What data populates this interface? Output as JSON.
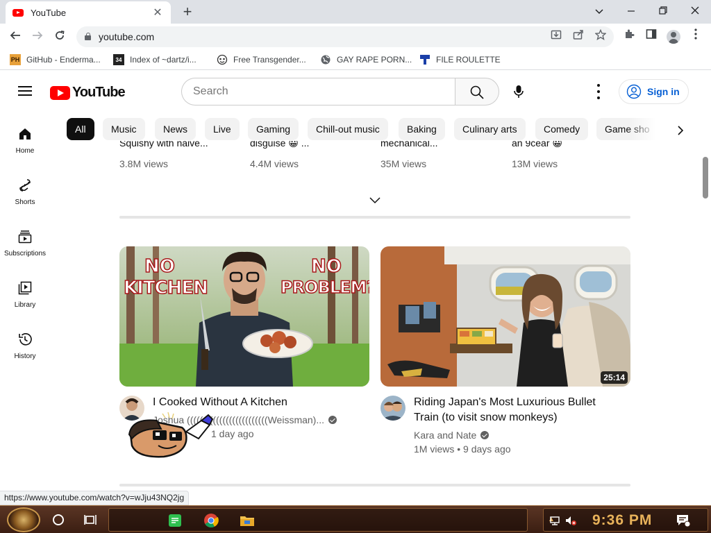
{
  "browser": {
    "tab_title": "YouTube",
    "url": "youtube.com",
    "bookmarks": [
      {
        "label": "GitHub - Enderma..."
      },
      {
        "label": "Index of ~dartz/i..."
      },
      {
        "label": "Free Transgender..."
      },
      {
        "label": "GAY RAPE PORN..."
      },
      {
        "label": "FILE ROULETTE"
      }
    ],
    "bookmark_badges": {
      "github": "PH",
      "index": "34"
    },
    "status_url": "https://www.youtube.com/watch?v=wJju43NQ2jg"
  },
  "header": {
    "logo_text": "YouTube",
    "search_placeholder": "Search",
    "signin_label": "Sign in"
  },
  "guide": [
    {
      "label": "Home"
    },
    {
      "label": "Shorts"
    },
    {
      "label": "Subscriptions"
    },
    {
      "label": "Library"
    },
    {
      "label": "History"
    }
  ],
  "chips": [
    {
      "label": "All",
      "active": true
    },
    {
      "label": "Music"
    },
    {
      "label": "News"
    },
    {
      "label": "Live"
    },
    {
      "label": "Gaming"
    },
    {
      "label": "Chill-out music"
    },
    {
      "label": "Baking"
    },
    {
      "label": "Culinary arts"
    },
    {
      "label": "Comedy"
    },
    {
      "label": "Game sho"
    }
  ],
  "shorts_shelf": [
    {
      "title_cut": "Squishy with naive...",
      "views": "3.8M views"
    },
    {
      "title_cut": "disguise 😀 ...",
      "views": "4.4M views"
    },
    {
      "title_cut": "mechanical...",
      "views": "35M views"
    },
    {
      "title_cut": "an 9cear 😀",
      "views": "13M views"
    }
  ],
  "videos": [
    {
      "title": "I Cooked Without A Kitchen",
      "channel": "Joshua (((((((((((((((((((((((((Weissman)...",
      "meta": "1 day ago",
      "thumb_text_left_1": "NO",
      "thumb_text_left_2": "KITCHEN",
      "thumb_text_right_1": "NO",
      "thumb_text_right_2": "PROBLEM?"
    },
    {
      "title_line1": "Riding Japan's Most Luxurious Bullet",
      "title_line2": "Train (to visit snow monkeys)",
      "channel": "Kara and Nate",
      "meta": "1M views • 9 days ago",
      "duration": "25:14"
    }
  ],
  "taskbar": {
    "clock": "9:36 PM"
  },
  "colors": {
    "yt_red": "#ff0000",
    "link_blue": "#065fd4",
    "chip_active": "#0f0f0f",
    "clock_amber": "#e8b25a"
  }
}
